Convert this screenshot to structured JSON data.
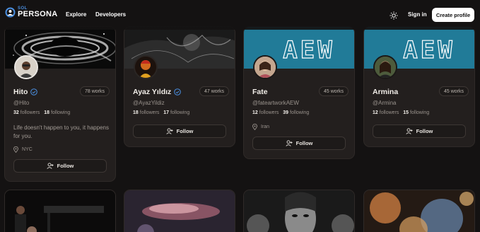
{
  "header": {
    "logo_small": "SOL",
    "logo_big": "PERSONA",
    "nav": [
      "Explore",
      "Developers"
    ],
    "theme_icon": "sun-icon",
    "signin": "Sign in",
    "create": "Create profile"
  },
  "profiles": [
    {
      "name": "Hito",
      "verified": true,
      "works": "78 works",
      "handle": "@Hito",
      "followers": "32",
      "followers_label": "followers",
      "following": "18",
      "following_label": "following",
      "bio": "Life doesn't happen to you, it happens for you.",
      "location": "NYC",
      "follow": "Follow"
    },
    {
      "name": "Ayaz Yıldız",
      "verified": true,
      "works": "47 works",
      "handle": "@AyazYildiz",
      "followers": "18",
      "followers_label": "followers",
      "following": "17",
      "following_label": "following",
      "bio": "",
      "location": "",
      "follow": "Follow"
    },
    {
      "name": "Fate",
      "verified": false,
      "works": "45 works",
      "handle": "@fateartworkAEW",
      "followers": "12",
      "followers_label": "followers",
      "following": "39",
      "following_label": "following",
      "bio": "",
      "location": "Iran",
      "follow": "Follow"
    },
    {
      "name": "Armina",
      "verified": false,
      "works": "45 works",
      "handle": "@Armina",
      "followers": "12",
      "followers_label": "followers",
      "following": "15",
      "following_label": "following",
      "bio": "",
      "location": "",
      "follow": "Follow"
    }
  ],
  "banner_text": "AEW",
  "colors": {
    "accent": "#4a8fe0",
    "card_bg": "#231f1e",
    "page_bg": "#141212",
    "banner_teal": "#2b8aa8"
  }
}
